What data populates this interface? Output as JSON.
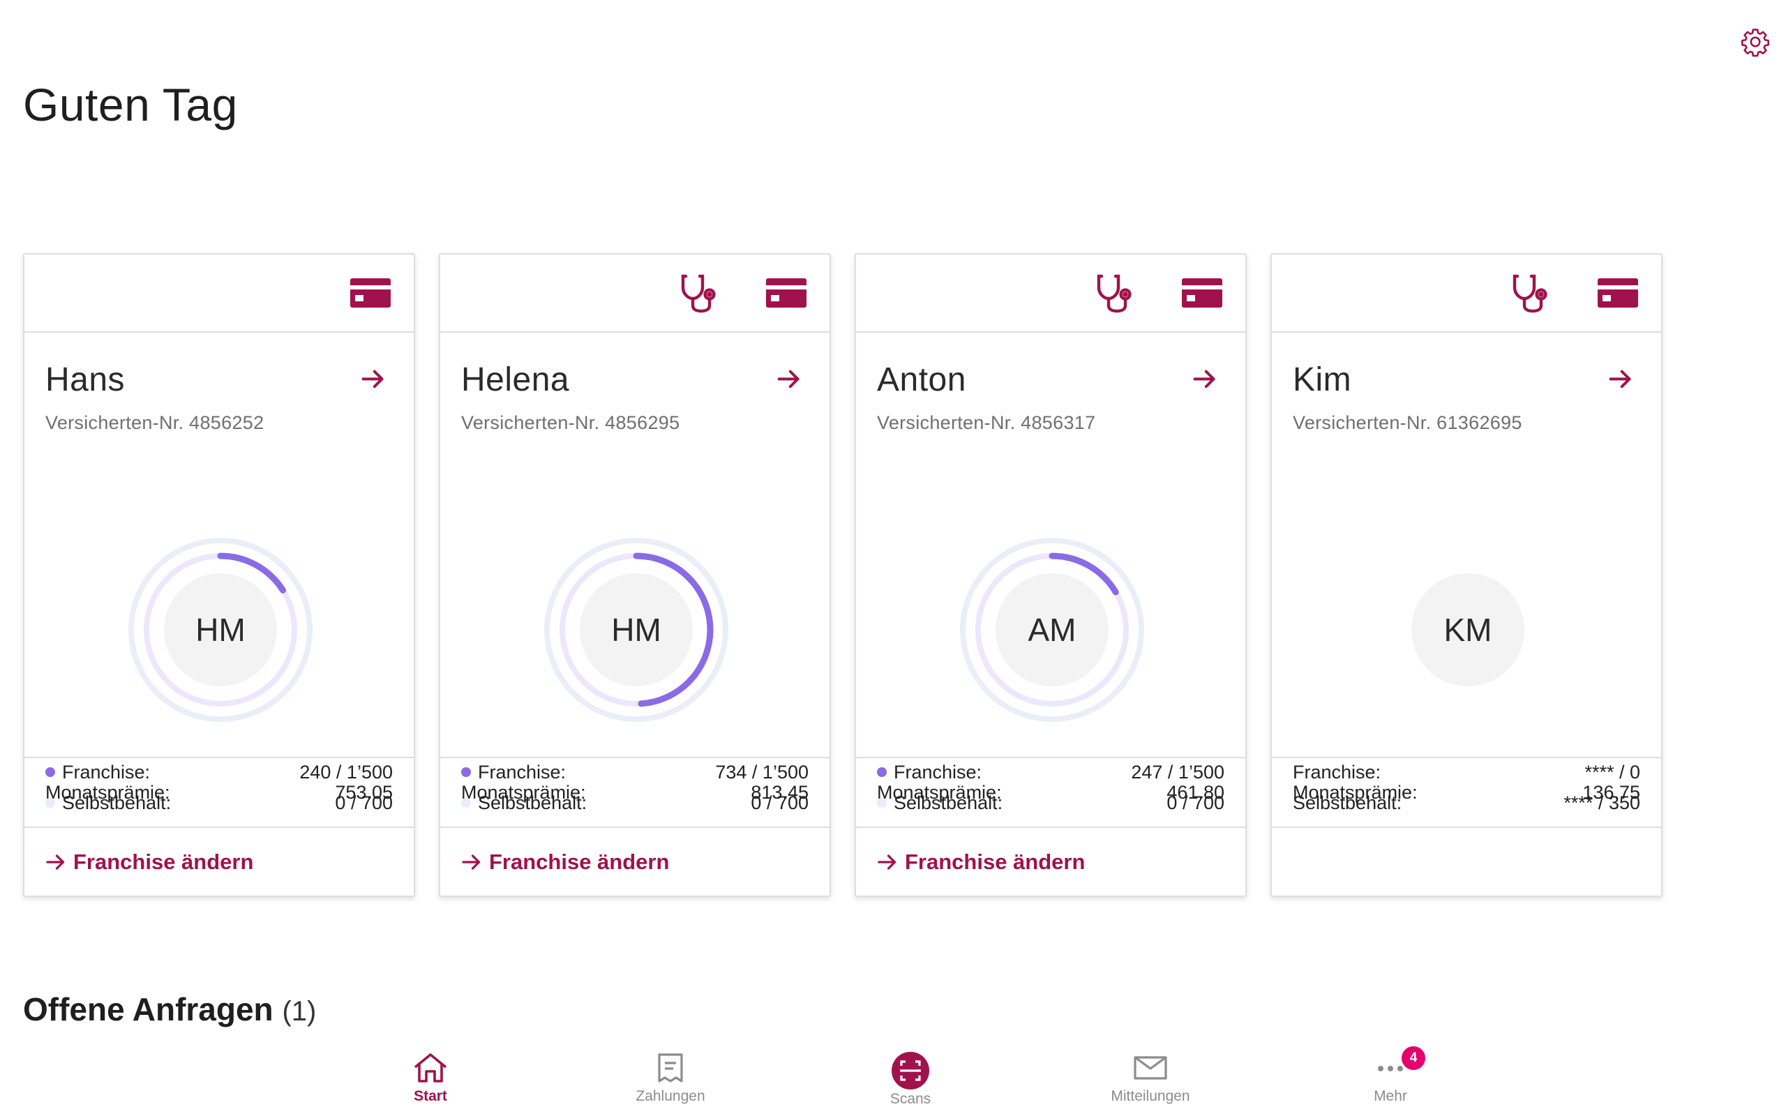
{
  "header": {
    "greeting": "Guten Tag"
  },
  "colors": {
    "brand": "#a0124b",
    "franchise_dot": "#8b6ae6",
    "selbstbehalt_dot": "#e8eef8",
    "badge": "#e6006e"
  },
  "cards": [
    {
      "name": "Hans",
      "policy_label": "Versicherten-Nr. 4856252",
      "initials": "HM",
      "has_doctor_icon": false,
      "franchise_used": 240,
      "franchise_total": 1500,
      "stats": [
        {
          "label": "Franchise:",
          "value": "240 / 1’500",
          "dot": true
        },
        {
          "label": "Selbstbehalt:",
          "value": "0 / 700",
          "dot": true
        }
      ],
      "premium_label": "Monatsprämie:",
      "premium_value": "753.05",
      "action_label": "Franchise ändern"
    },
    {
      "name": "Helena",
      "policy_label": "Versicherten-Nr. 4856295",
      "initials": "HM",
      "has_doctor_icon": true,
      "franchise_used": 734,
      "franchise_total": 1500,
      "stats": [
        {
          "label": "Franchise:",
          "value": "734 / 1’500",
          "dot": true
        },
        {
          "label": "Selbstbehalt:",
          "value": "0 / 700",
          "dot": true
        }
      ],
      "premium_label": "Monatsprämie:",
      "premium_value": "813.45",
      "action_label": "Franchise ändern"
    },
    {
      "name": "Anton",
      "policy_label": "Versicherten-Nr. 4856317",
      "initials": "AM",
      "has_doctor_icon": true,
      "franchise_used": 247,
      "franchise_total": 1500,
      "stats": [
        {
          "label": "Franchise:",
          "value": "247 / 1’500",
          "dot": true
        },
        {
          "label": "Selbstbehalt:",
          "value": "0 / 700",
          "dot": true
        }
      ],
      "premium_label": "Monatsprämie:",
      "premium_value": "461.80",
      "action_label": "Franchise ändern"
    },
    {
      "name": "Kim",
      "policy_label": "Versicherten-Nr. 61362695",
      "initials": "KM",
      "has_doctor_icon": true,
      "franchise_used": null,
      "franchise_total": null,
      "stats": [
        {
          "label": "Franchise:",
          "value": "**** / 0",
          "dot": false
        },
        {
          "label": "Selbstbehalt:",
          "value": "**** / 350",
          "dot": false
        }
      ],
      "premium_label": "Monatsprämie:",
      "premium_value": "136.75",
      "action_label": null
    }
  ],
  "requests": {
    "title": "Offene Anfragen",
    "count": "(1)"
  },
  "nav": {
    "items": [
      {
        "label": "Start",
        "icon": "home-icon",
        "active": true
      },
      {
        "label": "Zahlungen",
        "icon": "receipt-icon",
        "active": false
      },
      {
        "label": "Scans",
        "icon": "scan-icon",
        "active": false
      },
      {
        "label": "Mitteilungen",
        "icon": "mail-icon",
        "active": false
      },
      {
        "label": "Mehr",
        "icon": "more-icon",
        "active": false,
        "badge": "4"
      }
    ]
  }
}
